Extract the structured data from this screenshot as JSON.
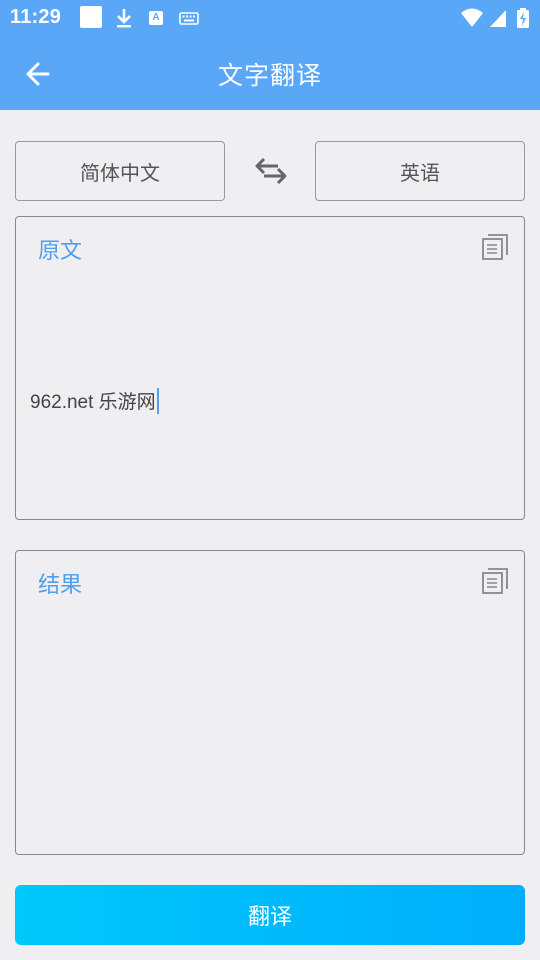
{
  "status_bar": {
    "time": "11:29",
    "icons": [
      "app-square-icon",
      "download-icon",
      "a-icon",
      "keyboard-icon",
      "wifi-icon",
      "signal-icon",
      "battery-icon"
    ],
    "a_label": "A"
  },
  "toolbar": {
    "title": "文字翻译",
    "back_icon": "arrow-left-icon"
  },
  "languages": {
    "source": "简体中文",
    "target": "英语",
    "swap_icon": "swap-arrows-icon"
  },
  "source_panel": {
    "label": "原文",
    "text": "962.net 乐游网",
    "copy_icon": "copy-icon"
  },
  "result_panel": {
    "label": "结果",
    "text": "",
    "copy_icon": "copy-icon"
  },
  "actions": {
    "translate_label": "翻译"
  },
  "colors": {
    "header": "#5aa7f8",
    "accent": "#4f9ef0",
    "button_start": "#00c8fb",
    "button_end": "#00aefc",
    "background": "#efeff2"
  }
}
